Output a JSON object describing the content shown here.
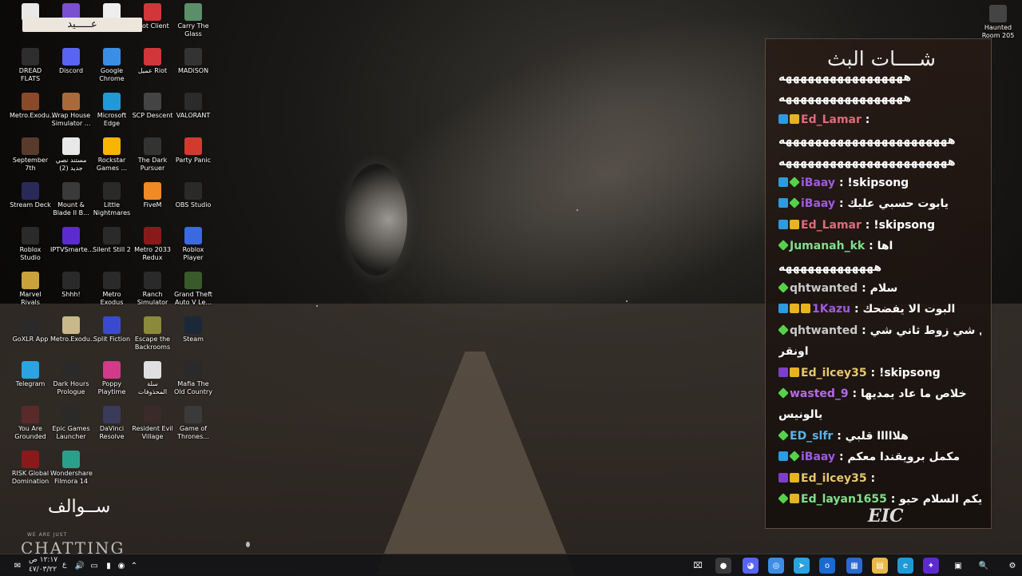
{
  "desktop_icons": [
    {
      "label": "",
      "color": "#e8e8e8"
    },
    {
      "label": "",
      "color": "#7a4fd0"
    },
    {
      "label": "",
      "color": "#eeeeee"
    },
    {
      "label": "Riot Client",
      "color": "#d13639"
    },
    {
      "label": "Carry The Glass",
      "color": "#5b8f6a"
    },
    {
      "label": "DREAD FLATS",
      "color": "#2e2e2e"
    },
    {
      "label": "Discord",
      "color": "#5865f2"
    },
    {
      "label": "Google Chrome",
      "color": "#3b8ee6"
    },
    {
      "label": "عميل Riot",
      "color": "#d13639"
    },
    {
      "label": "MADiSON",
      "color": "#333333"
    },
    {
      "label": "Metro.Exodu...",
      "color": "#8a4a2a"
    },
    {
      "label": "Wrap House Simulator ...",
      "color": "#a86a3a"
    },
    {
      "label": "Microsoft Edge",
      "color": "#1f9ad6"
    },
    {
      "label": "SCP Descent",
      "color": "#444444"
    },
    {
      "label": "VALORANT",
      "color": "#2b2b2b"
    },
    {
      "label": "September 7th",
      "color": "#5a3a2a"
    },
    {
      "label": "مستند نصي جديد (2)",
      "color": "#e8e8e8"
    },
    {
      "label": "Rockstar Games ...",
      "color": "#f7b500"
    },
    {
      "label": "The Dark Pursuer",
      "color": "#333333"
    },
    {
      "label": "Party Panic",
      "color": "#d33a2f"
    },
    {
      "label": "Stream Deck",
      "color": "#2a2a5a"
    },
    {
      "label": "Mount & Blade II B...",
      "color": "#3a3a3a"
    },
    {
      "label": "Little Nightmares",
      "color": "#2a2a2a"
    },
    {
      "label": "FiveM",
      "color": "#f08a24"
    },
    {
      "label": "OBS Studio",
      "color": "#2a2a2a"
    },
    {
      "label": "Roblox Studio",
      "color": "#2a2a2a"
    },
    {
      "label": "IPTVSmarte...",
      "color": "#5b2bd0"
    },
    {
      "label": "Silent Still 2",
      "color": "#2a2a2a"
    },
    {
      "label": "Metro 2033 Redux",
      "color": "#8a1a1a"
    },
    {
      "label": "Roblox Player",
      "color": "#3a6ae0"
    },
    {
      "label": "Marvel Rivals",
      "color": "#c9a23a"
    },
    {
      "label": "Shhh!",
      "color": "#2a2a2a"
    },
    {
      "label": "Metro Exodus",
      "color": "#2a2a2a"
    },
    {
      "label": "Ranch Simulator",
      "color": "#2a2a2a"
    },
    {
      "label": "Grand Theft Auto V Le...",
      "color": "#3a5a2a"
    },
    {
      "label": "GoXLR App",
      "color": "#2a2a2a"
    },
    {
      "label": "Metro.Exodu...",
      "color": "#c9b88a"
    },
    {
      "label": "Split Fiction",
      "color": "#3a4ad0"
    },
    {
      "label": "Escape the Backrooms",
      "color": "#8a8a3a"
    },
    {
      "label": "Steam",
      "color": "#1b2838"
    },
    {
      "label": "Telegram",
      "color": "#2aa3e0"
    },
    {
      "label": "Dark Hours Prologue",
      "color": "#2a2a2a"
    },
    {
      "label": "Poppy Playtime",
      "color": "#d33a8a"
    },
    {
      "label": "سلة المحذوفات",
      "color": "#e0e0e0"
    },
    {
      "label": "Mafia The Old Country",
      "color": "#2a2a2a"
    },
    {
      "label": "You Are Grounded",
      "color": "#5a2a2a"
    },
    {
      "label": "Epic Games Launcher",
      "color": "#2a2a2a"
    },
    {
      "label": "DaVinci Resolve",
      "color": "#3a3a5a"
    },
    {
      "label": "Resident Evil Village",
      "color": "#3a2a2a"
    },
    {
      "label": "Game of Thrones...",
      "color": "#3a3a3a"
    },
    {
      "label": "RISK Global Domination",
      "color": "#8a1a1a"
    },
    {
      "label": "Wondershare Filmora 14",
      "color": "#2aa08a"
    },
    {
      "label": "Haunted Room 205",
      "color": "#444444"
    }
  ],
  "chat": {
    "title": "شــــات البث",
    "lines": [
      {
        "badges": [],
        "name": "",
        "name_color": "#ffffff",
        "message": "هههههههههههههههههه"
      },
      {
        "badges": [],
        "name": "",
        "name_color": "#ffffff",
        "message": "هههههههههههههههههه"
      },
      {
        "badges": [
          "b-blue",
          "b-gold"
        ],
        "name": "Ed_Lamar",
        "name_color": "#e06a7a",
        "message": ":"
      },
      {
        "badges": [],
        "name": "",
        "name_color": "#ffffff",
        "message": "هههههههههههههههههههههههه"
      },
      {
        "badges": [],
        "name": "",
        "name_color": "#ffffff",
        "message": "هههههههههههههههههههههههه"
      },
      {
        "badges": [
          "b-blue",
          "b-green"
        ],
        "name": "iBaay",
        "name_color": "#a05adf",
        "message": ": !skipsong"
      },
      {
        "badges": [
          "b-blue",
          "b-green"
        ],
        "name": "iBaay",
        "name_color": "#a05adf",
        "message": ": يابوت حسبي عليك"
      },
      {
        "badges": [
          "b-blue",
          "b-gold"
        ],
        "name": "Ed_Lamar",
        "name_color": "#e06a7a",
        "message": ": !skipsong"
      },
      {
        "badges": [
          "b-green"
        ],
        "name": "Jumanah_kk",
        "name_color": "#7fe08a",
        "message": ": اها"
      },
      {
        "badges": [],
        "name": "",
        "name_color": "#ffffff",
        "message": "هههههههههههههه"
      },
      {
        "badges": [
          "b-green"
        ],
        "name": "qhtwanted",
        "name_color": "#c9c9c9",
        "message": ": سلام"
      },
      {
        "badges": [
          "b-blue",
          "b-gold",
          "b-gold"
        ],
        "name": "1Kazu",
        "name_color": "#a05adf",
        "message": ": البوت الا يفضحك"
      },
      {
        "badges": [
          "b-green"
        ],
        "name": "qhtwanted",
        "name_color": "#c9c9c9",
        "message": ": اول شي زوط ثاني شي"
      },
      {
        "badges": [],
        "name": "",
        "name_color": "#ffffff",
        "message": "اونقر"
      },
      {
        "badges": [
          "b-purple",
          "b-gold"
        ],
        "name": "Ed_ilcey35",
        "name_color": "#e8c86a",
        "message": ": !skipsong"
      },
      {
        "badges": [
          "b-green"
        ],
        "name": "wasted_9",
        "name_color": "#b46ae8",
        "message": ": خلاص ما عاد يمديها"
      },
      {
        "badges": [],
        "name": "",
        "name_color": "#ffffff",
        "message": "يالونيس"
      },
      {
        "badges": [
          "b-green"
        ],
        "name": "ED_slfr",
        "name_color": "#5ab4e8",
        "message": ": هلااااا قلبي"
      },
      {
        "badges": [
          "b-blue",
          "b-green"
        ],
        "name": "iBaay",
        "name_color": "#a05adf",
        "message": ": مكمل برويقندا معكم"
      },
      {
        "badges": [
          "b-purple",
          "b-gold"
        ],
        "name": "Ed_ilcey35",
        "name_color": "#e8c86a",
        "message": ":"
      },
      {
        "badges": [
          "b-green",
          "b-gold"
        ],
        "name": "Ed_layan1655",
        "name_color": "#7fe08a",
        "message": ": وعليكم السلام حبو"
      }
    ],
    "logo": "EIC"
  },
  "overlay": {
    "top_text": "عـــــيد",
    "title": "ســوالف",
    "small": "WE ARE JUST",
    "big": "CHATTING"
  },
  "taskbar": {
    "time": "١٢:١٧ ص",
    "date": "٤٧/٠٣/٢٢",
    "lang": "ع"
  }
}
